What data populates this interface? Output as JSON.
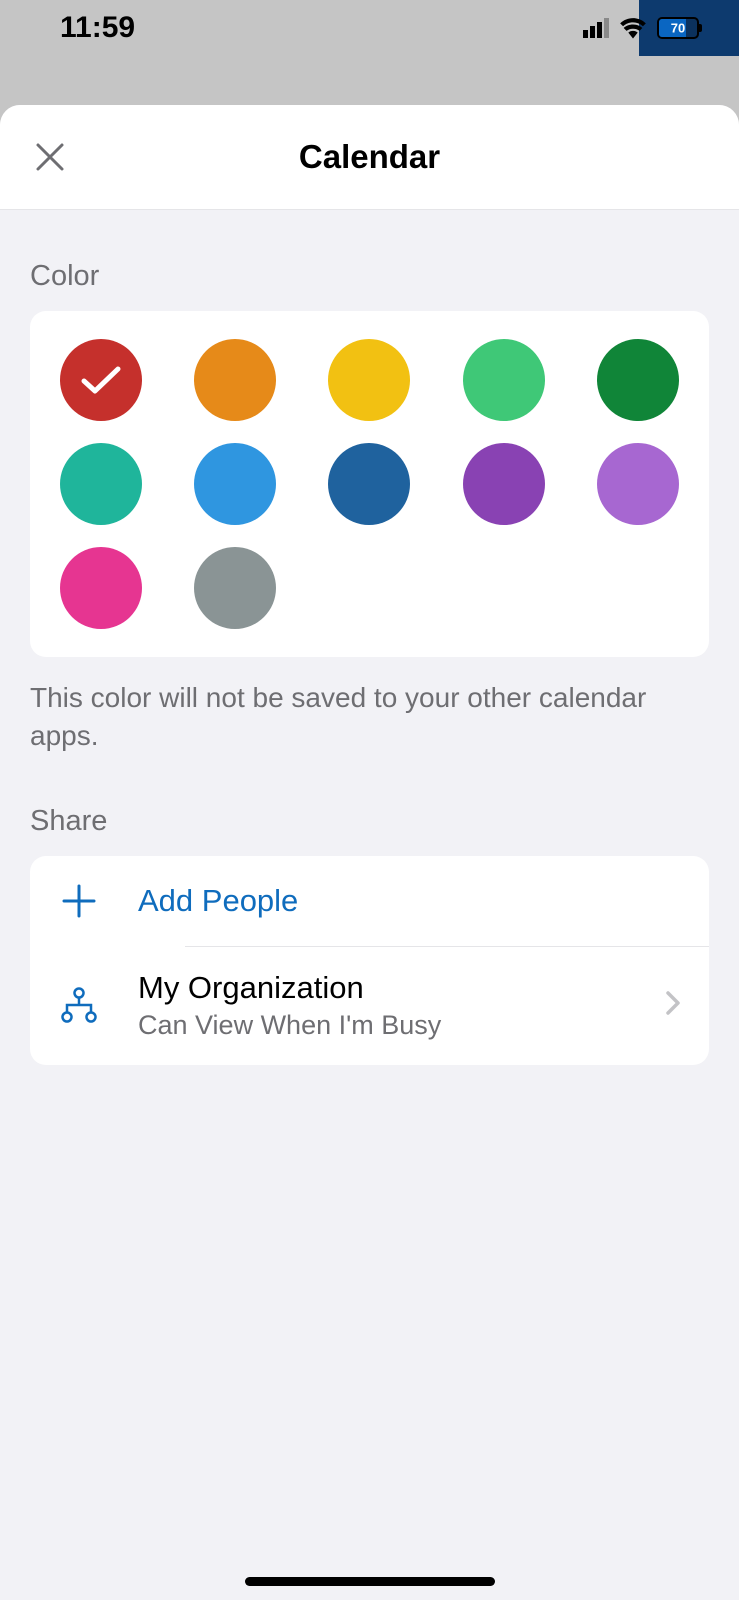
{
  "statusBar": {
    "time": "11:59",
    "batteryPercent": "70",
    "batteryFillPercent": 70
  },
  "modal": {
    "title": "Calendar"
  },
  "colorSection": {
    "label": "Color",
    "helpText": "This color will not be saved to your other calendar apps.",
    "selectedIndex": 0,
    "colors": [
      {
        "name": "red",
        "hex": "#c5302c"
      },
      {
        "name": "orange",
        "hex": "#e68a19"
      },
      {
        "name": "yellow",
        "hex": "#f2c112"
      },
      {
        "name": "green",
        "hex": "#3fc877"
      },
      {
        "name": "dark-green",
        "hex": "#108538"
      },
      {
        "name": "teal",
        "hex": "#1fb59b"
      },
      {
        "name": "blue",
        "hex": "#2f96e0"
      },
      {
        "name": "dark-blue",
        "hex": "#1f629e"
      },
      {
        "name": "purple",
        "hex": "#8942b3"
      },
      {
        "name": "light-purple",
        "hex": "#a767d1"
      },
      {
        "name": "pink",
        "hex": "#e63591"
      },
      {
        "name": "gray",
        "hex": "#8a9495"
      }
    ]
  },
  "shareSection": {
    "label": "Share",
    "addPeople": {
      "label": "Add People"
    },
    "organization": {
      "title": "My Organization",
      "subtitle": "Can View When I'm Busy"
    }
  }
}
